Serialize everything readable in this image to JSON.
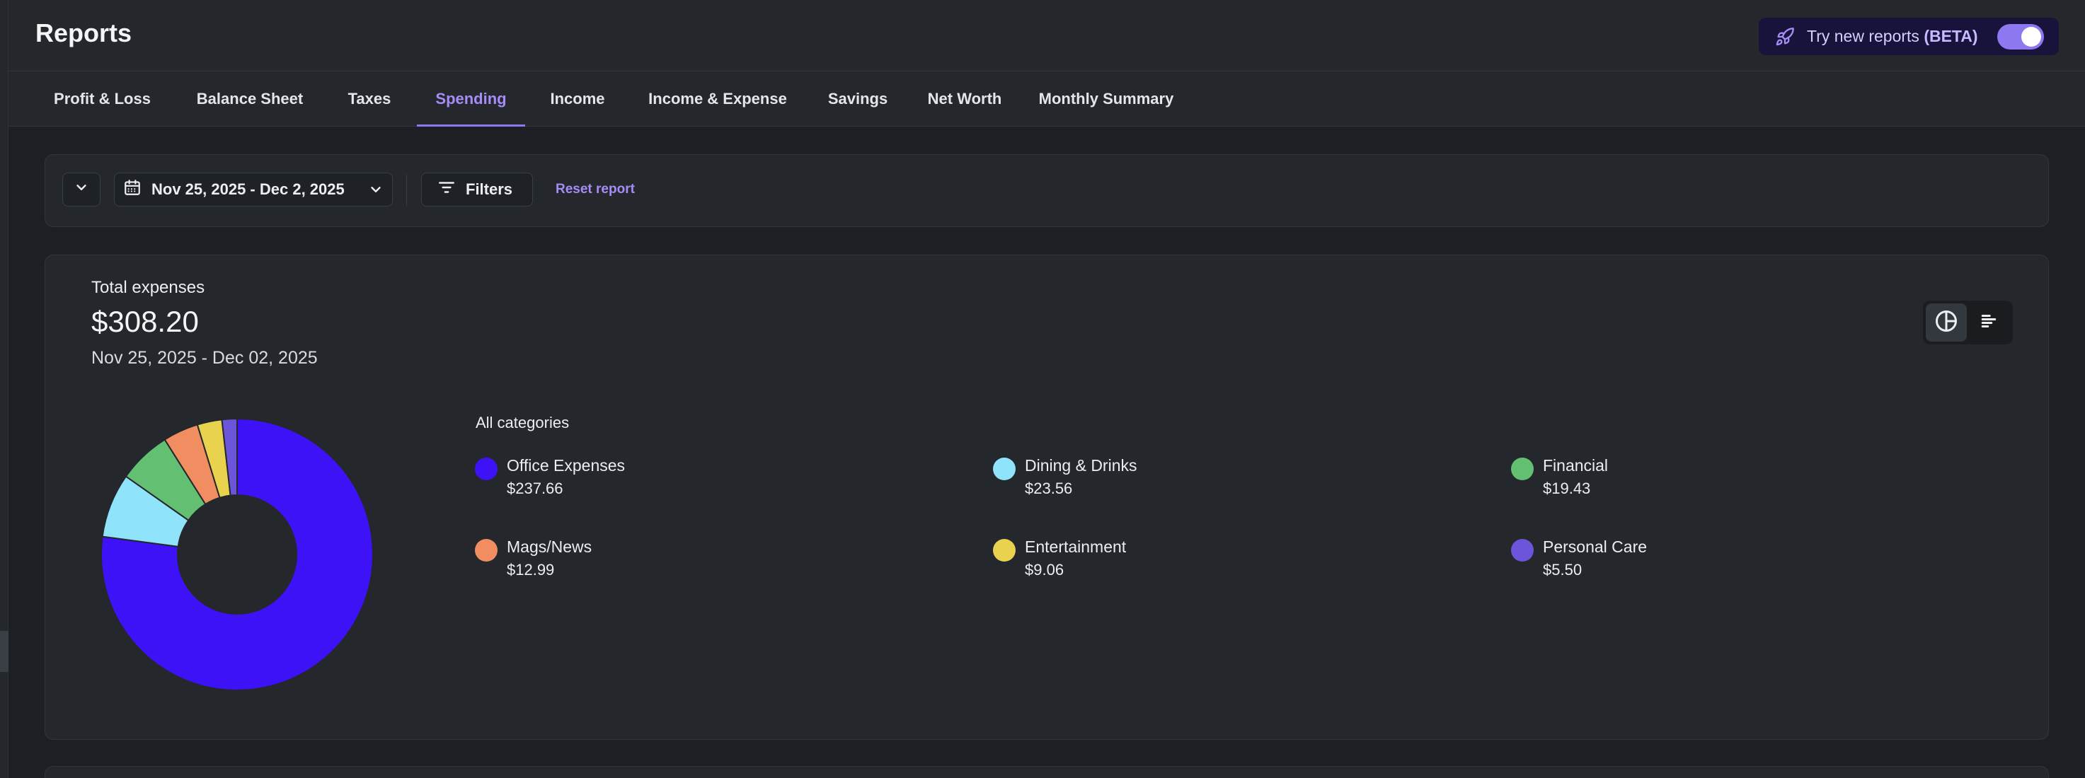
{
  "header": {
    "title": "Reports",
    "beta_prefix": "Try new reports ",
    "beta_bold": "(BETA)",
    "beta_enabled": true
  },
  "tabs": [
    {
      "label": "Profit & Loss"
    },
    {
      "label": "Balance Sheet"
    },
    {
      "label": "Taxes"
    },
    {
      "label": "Spending",
      "active": true
    },
    {
      "label": "Income"
    },
    {
      "label": "Income & Expense"
    },
    {
      "label": "Savings"
    },
    {
      "label": "Net Worth"
    },
    {
      "label": "Monthly Summary"
    }
  ],
  "filters": {
    "date_range": "Nov 25, 2025 - Dec 2, 2025",
    "filters_label": "Filters",
    "reset_label": "Reset report"
  },
  "summary": {
    "total_label": "Total expenses",
    "total_value": "$308.20",
    "range": "Nov 25, 2025 - Dec 02, 2025"
  },
  "legend": {
    "title": "All categories",
    "items": [
      {
        "name": "Office Expenses",
        "amount": "$237.66",
        "color": "#3d12f6"
      },
      {
        "name": "Dining & Drinks",
        "amount": "$23.56",
        "color": "#8fe3fb"
      },
      {
        "name": "Financial",
        "amount": "$19.43",
        "color": "#63c073"
      },
      {
        "name": "Mags/News",
        "amount": "$12.99",
        "color": "#f08e62"
      },
      {
        "name": "Entertainment",
        "amount": "$9.06",
        "color": "#e9d34e"
      },
      {
        "name": "Personal Care",
        "amount": "$5.50",
        "color": "#6d55db"
      }
    ]
  },
  "chart_data": {
    "type": "pie",
    "donut": true,
    "categories": [
      "Office Expenses",
      "Dining & Drinks",
      "Financial",
      "Mags/News",
      "Entertainment",
      "Personal Care"
    ],
    "values": [
      237.66,
      23.56,
      19.43,
      12.99,
      9.06,
      5.5
    ],
    "colors": [
      "#3d12f6",
      "#8fe3fb",
      "#63c073",
      "#f08e62",
      "#e9d34e",
      "#6d55db"
    ],
    "total": 308.2
  },
  "colors": {
    "accent": "#8e78f0",
    "accent_text": "#a58df5",
    "background": "#1c1f24",
    "panel": "#24272c"
  }
}
